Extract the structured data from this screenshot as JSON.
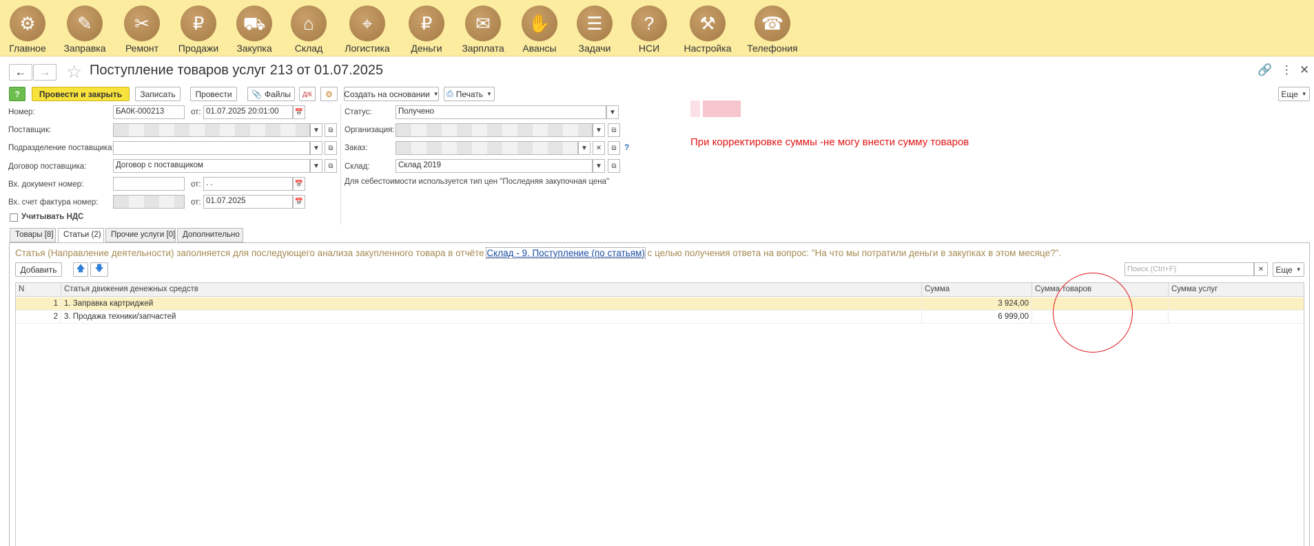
{
  "sections": [
    {
      "label": "Главное",
      "icon": "⚙"
    },
    {
      "label": "Заправка",
      "icon": "✎"
    },
    {
      "label": "Ремонт",
      "icon": "✂"
    },
    {
      "label": "Продажи",
      "icon": "₽"
    },
    {
      "label": "Закупка",
      "icon": "⛟"
    },
    {
      "label": "Склад",
      "icon": "⌂"
    },
    {
      "label": "Логистика",
      "icon": "⌖"
    },
    {
      "label": "Деньги",
      "icon": "₽"
    },
    {
      "label": "Зарплата",
      "icon": "✉"
    },
    {
      "label": "Авансы",
      "icon": "✋"
    },
    {
      "label": "Задачи",
      "icon": "☰"
    },
    {
      "label": "НСИ",
      "icon": "?"
    },
    {
      "label": "Настройка",
      "icon": "⚒"
    },
    {
      "label": "Телефония",
      "icon": "☎"
    }
  ],
  "title": "Поступление товаров услуг 213 от 01.07.2025",
  "toolbar": {
    "help": "?",
    "post_close": "Провести и закрыть",
    "save": "Записать",
    "post": "Провести",
    "files": "Файлы",
    "create_based": "Создать на основании",
    "print": "Печать",
    "more": "Еще"
  },
  "form": {
    "number_label": "Номер:",
    "number": "БА0К-000213",
    "from_label": "от:",
    "date": "01.07.2025 20:01:00",
    "supplier_label": "Поставщик:",
    "supplier_division_label": "Подразделение поставщика:",
    "contract_label": "Договор поставщика:",
    "contract": "Договор с поставщиком",
    "in_doc_label": "Вх. документ номер:",
    "in_doc_date": " .  .",
    "in_invoice_label": "Вх. счет фактура номер:",
    "in_invoice_date": "01.07.2025",
    "vat_label": "Учитывать НДС",
    "status_label": "Статус:",
    "status": "Получено",
    "org_label": "Организация:",
    "order_label": "Заказ:",
    "warehouse_label": "Склад:",
    "warehouse": "Склад 2019",
    "cost_note": "Для себестоимости используется тип цен \"Последняя закупочная цена\""
  },
  "remark": "При корректировке суммы -не могу внести сумму товаров",
  "tabs": [
    "Товары [8]",
    "Статьи (2)",
    "Прочие услуги [0]",
    "Дополнительно"
  ],
  "hint": {
    "before": "Статья (Направление деятельности) заполняется для последующего анализа закупленного товара в отчёте ",
    "link": "Склад - 9. Поступление (по статьям)",
    "after": " с целью получения ответа на вопрос: \"На что мы потратили деньги в закупках в этом месяце?\"."
  },
  "table_toolbar": {
    "add": "Добавить",
    "search_placeholder": "Поиск (Ctrl+F)",
    "more": "Еще"
  },
  "table": {
    "columns": [
      "N",
      "Статья движения денежных средств",
      "Сумма",
      "Сумма товаров",
      "Сумма услуг"
    ],
    "rows": [
      {
        "n": "1",
        "article": "1. Заправка картриджей",
        "sum": "3 924,00",
        "goods": "",
        "services": ""
      },
      {
        "n": "2",
        "article": "3. Продажа техники/запчастей",
        "sum": "6 999,00",
        "goods": "",
        "services": ""
      }
    ]
  }
}
